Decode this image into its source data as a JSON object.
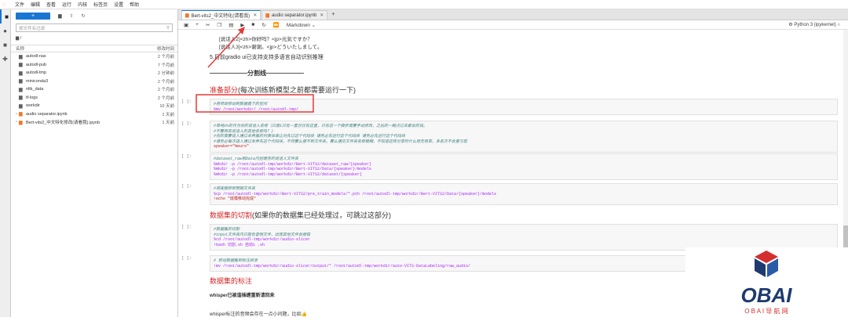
{
  "menubar": {
    "items": [
      "文件",
      "编辑",
      "查看",
      "运行",
      "内核",
      "标签页",
      "设置",
      "帮助"
    ]
  },
  "activity": {
    "icons": [
      "folder-icon",
      "running-icon",
      "command-icon",
      "puzzle-icon"
    ]
  },
  "filebrowser": {
    "new_label": "+",
    "search_placeholder": "按文件名过滤",
    "breadcrumb": "/",
    "col_name": "名称",
    "col_modified": "修改时间",
    "files": [
      {
        "name": "autodl-nas",
        "modified": "2 个月前",
        "type": "folder"
      },
      {
        "name": "autodl-pub",
        "modified": "7 个月前",
        "type": "folder"
      },
      {
        "name": "autodl-tmp",
        "modified": "2 分钟前",
        "type": "folder"
      },
      {
        "name": "miniconda3",
        "modified": "2 个月前",
        "type": "folder"
      },
      {
        "name": "nltk_data",
        "modified": "2 个月前",
        "type": "folder"
      },
      {
        "name": "tf-logs",
        "modified": "2 个月前",
        "type": "folder"
      },
      {
        "name": "workdir",
        "modified": "10 天前",
        "type": "folder"
      },
      {
        "name": "audio separator.ipynb",
        "modified": "1 天前",
        "type": "notebook"
      },
      {
        "name": "Bert-vits2_中文特化修改(请看我).ipynb",
        "modified": "1 天前",
        "type": "notebook"
      }
    ]
  },
  "tabs": [
    {
      "label": "Bert-vits2_中文特化(请看我)",
      "active": true
    },
    {
      "label": "audio separator.ipynb",
      "active": false
    }
  ],
  "toolbar": {
    "cell_type": "Markdown",
    "kernel": "Python 3 (ipykernel)"
  },
  "notebook": {
    "intro_lines": [
      "[说话人2]<zh>你好吗？<jp>元気ですか？",
      "[说话人3]<zh>谢谢。<jp>どういたしまして。"
    ],
    "note": "5.目前gradio ui已支持支持多语言自动识别推理",
    "divider": "——————分割线——————",
    "prep_red": "准备部分",
    "prep_rest": "(每次训练新模型之前都需要运行一下)",
    "cell1": [
      "#将项目移动到数据盘下的空间",
      "%mv /root/workdir/ /root/autodl-tmp/"
    ],
    "cell2": [
      "#单纯sh的作为你的说话人名称（只需1只有一套且仅有这里，只有这一个脚步需要手动修改，之后的一概点过去都会的找。",
      "#不要用名说话人的其他名称吗？)",
      "#你的需要说入通过本养面的列表体来让对先过这个代码块 请务必先运行这个代码块 请务必先运行这个代码块",
      "#请务必每次进入通过本养先这个代码块，不然要么报不到文件夹，要么遇见文件夹名称模糊，不知道这样分享时什么用无用率，多名次不会重写前",
      "speaker=\"Neuro\""
    ],
    "cell3": [
      "#dataset_raw和Data内创建存的说话人文件夹",
      "%mkdir -p /root/autodl-tmp/workdir/Bert-VITS2/dataset_raw/{speaker}",
      "%mkdir -p /root/autodl-tmp/workdir/Bert-VITS2/Data/{speaker}/models",
      "%mkdir -p /root/autodl-tmp/workdir/Bert-VITS2/dataset/{speaker}"
    ],
    "cell4": [
      "#将底模移到预期文件夹",
      "%cp /root/autodl-tmp/workdir/Bert-VITS2/pre_train_models/*.pth /root/autodl-tmp/workdir/Bert-VITS2/Data/{speaker}/models",
      "!echo \"底模移动完成\""
    ],
    "cut_red": "数据集的切割",
    "cut_rest": "(如果你的数据集已经处理过，可跳过这部分)",
    "cell5": [
      "#数据集的切割",
      "#input文件夹内只能有音频文件，出现其他文件会报错",
      "%cd /root/autodl-tmp/workdir/audio-slicer",
      "!bash 切割.sh 自动1 .sh"
    ],
    "cell6": [
      "# 移动数据集到标注目录",
      "!mv /root/autodl-tmp/workdir/audio-slicer/output/* /root/autodl-tmp/workdir/auto-VITS-DataLabeling/raw_audio/"
    ],
    "label_red": "数据集的标注",
    "whisper_bold": "whisper已被谐插缠重新请回来",
    "bottom_text": "whisper标注的音频会存在一点小问题，比如👍",
    "prompt": "[ ]:"
  },
  "brand": {
    "name": "OBAI",
    "tagline": "O B A I 导 航 网"
  }
}
